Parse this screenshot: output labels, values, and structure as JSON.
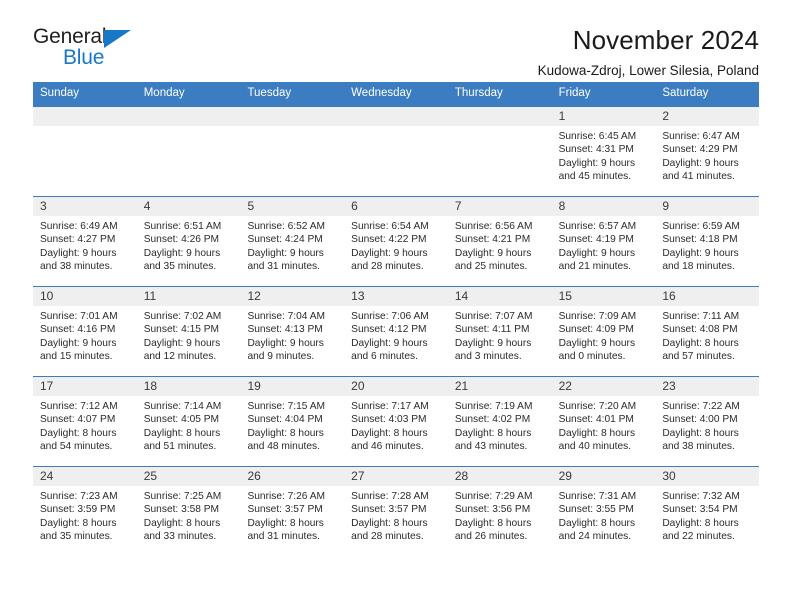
{
  "brand": {
    "name_part1": "General",
    "name_part2": "Blue",
    "accent_color": "#1878c8"
  },
  "header": {
    "title": "November 2024",
    "subtitle": "Kudowa-Zdroj, Lower Silesia, Poland"
  },
  "calendar": {
    "header_color": "#3b7dc0",
    "date_band_color": "#efefef",
    "weekdays": [
      "Sunday",
      "Monday",
      "Tuesday",
      "Wednesday",
      "Thursday",
      "Friday",
      "Saturday"
    ],
    "weeks": [
      [
        {
          "date": "",
          "empty": true
        },
        {
          "date": "",
          "empty": true
        },
        {
          "date": "",
          "empty": true
        },
        {
          "date": "",
          "empty": true
        },
        {
          "date": "",
          "empty": true
        },
        {
          "date": "1",
          "sunrise": "Sunrise: 6:45 AM",
          "sunset": "Sunset: 4:31 PM",
          "daylight": "Daylight: 9 hours and 45 minutes."
        },
        {
          "date": "2",
          "sunrise": "Sunrise: 6:47 AM",
          "sunset": "Sunset: 4:29 PM",
          "daylight": "Daylight: 9 hours and 41 minutes."
        }
      ],
      [
        {
          "date": "3",
          "sunrise": "Sunrise: 6:49 AM",
          "sunset": "Sunset: 4:27 PM",
          "daylight": "Daylight: 9 hours and 38 minutes."
        },
        {
          "date": "4",
          "sunrise": "Sunrise: 6:51 AM",
          "sunset": "Sunset: 4:26 PM",
          "daylight": "Daylight: 9 hours and 35 minutes."
        },
        {
          "date": "5",
          "sunrise": "Sunrise: 6:52 AM",
          "sunset": "Sunset: 4:24 PM",
          "daylight": "Daylight: 9 hours and 31 minutes."
        },
        {
          "date": "6",
          "sunrise": "Sunrise: 6:54 AM",
          "sunset": "Sunset: 4:22 PM",
          "daylight": "Daylight: 9 hours and 28 minutes."
        },
        {
          "date": "7",
          "sunrise": "Sunrise: 6:56 AM",
          "sunset": "Sunset: 4:21 PM",
          "daylight": "Daylight: 9 hours and 25 minutes."
        },
        {
          "date": "8",
          "sunrise": "Sunrise: 6:57 AM",
          "sunset": "Sunset: 4:19 PM",
          "daylight": "Daylight: 9 hours and 21 minutes."
        },
        {
          "date": "9",
          "sunrise": "Sunrise: 6:59 AM",
          "sunset": "Sunset: 4:18 PM",
          "daylight": "Daylight: 9 hours and 18 minutes."
        }
      ],
      [
        {
          "date": "10",
          "sunrise": "Sunrise: 7:01 AM",
          "sunset": "Sunset: 4:16 PM",
          "daylight": "Daylight: 9 hours and 15 minutes."
        },
        {
          "date": "11",
          "sunrise": "Sunrise: 7:02 AM",
          "sunset": "Sunset: 4:15 PM",
          "daylight": "Daylight: 9 hours and 12 minutes."
        },
        {
          "date": "12",
          "sunrise": "Sunrise: 7:04 AM",
          "sunset": "Sunset: 4:13 PM",
          "daylight": "Daylight: 9 hours and 9 minutes."
        },
        {
          "date": "13",
          "sunrise": "Sunrise: 7:06 AM",
          "sunset": "Sunset: 4:12 PM",
          "daylight": "Daylight: 9 hours and 6 minutes."
        },
        {
          "date": "14",
          "sunrise": "Sunrise: 7:07 AM",
          "sunset": "Sunset: 4:11 PM",
          "daylight": "Daylight: 9 hours and 3 minutes."
        },
        {
          "date": "15",
          "sunrise": "Sunrise: 7:09 AM",
          "sunset": "Sunset: 4:09 PM",
          "daylight": "Daylight: 9 hours and 0 minutes."
        },
        {
          "date": "16",
          "sunrise": "Sunrise: 7:11 AM",
          "sunset": "Sunset: 4:08 PM",
          "daylight": "Daylight: 8 hours and 57 minutes."
        }
      ],
      [
        {
          "date": "17",
          "sunrise": "Sunrise: 7:12 AM",
          "sunset": "Sunset: 4:07 PM",
          "daylight": "Daylight: 8 hours and 54 minutes."
        },
        {
          "date": "18",
          "sunrise": "Sunrise: 7:14 AM",
          "sunset": "Sunset: 4:05 PM",
          "daylight": "Daylight: 8 hours and 51 minutes."
        },
        {
          "date": "19",
          "sunrise": "Sunrise: 7:15 AM",
          "sunset": "Sunset: 4:04 PM",
          "daylight": "Daylight: 8 hours and 48 minutes."
        },
        {
          "date": "20",
          "sunrise": "Sunrise: 7:17 AM",
          "sunset": "Sunset: 4:03 PM",
          "daylight": "Daylight: 8 hours and 46 minutes."
        },
        {
          "date": "21",
          "sunrise": "Sunrise: 7:19 AM",
          "sunset": "Sunset: 4:02 PM",
          "daylight": "Daylight: 8 hours and 43 minutes."
        },
        {
          "date": "22",
          "sunrise": "Sunrise: 7:20 AM",
          "sunset": "Sunset: 4:01 PM",
          "daylight": "Daylight: 8 hours and 40 minutes."
        },
        {
          "date": "23",
          "sunrise": "Sunrise: 7:22 AM",
          "sunset": "Sunset: 4:00 PM",
          "daylight": "Daylight: 8 hours and 38 minutes."
        }
      ],
      [
        {
          "date": "24",
          "sunrise": "Sunrise: 7:23 AM",
          "sunset": "Sunset: 3:59 PM",
          "daylight": "Daylight: 8 hours and 35 minutes."
        },
        {
          "date": "25",
          "sunrise": "Sunrise: 7:25 AM",
          "sunset": "Sunset: 3:58 PM",
          "daylight": "Daylight: 8 hours and 33 minutes."
        },
        {
          "date": "26",
          "sunrise": "Sunrise: 7:26 AM",
          "sunset": "Sunset: 3:57 PM",
          "daylight": "Daylight: 8 hours and 31 minutes."
        },
        {
          "date": "27",
          "sunrise": "Sunrise: 7:28 AM",
          "sunset": "Sunset: 3:57 PM",
          "daylight": "Daylight: 8 hours and 28 minutes."
        },
        {
          "date": "28",
          "sunrise": "Sunrise: 7:29 AM",
          "sunset": "Sunset: 3:56 PM",
          "daylight": "Daylight: 8 hours and 26 minutes."
        },
        {
          "date": "29",
          "sunrise": "Sunrise: 7:31 AM",
          "sunset": "Sunset: 3:55 PM",
          "daylight": "Daylight: 8 hours and 24 minutes."
        },
        {
          "date": "30",
          "sunrise": "Sunrise: 7:32 AM",
          "sunset": "Sunset: 3:54 PM",
          "daylight": "Daylight: 8 hours and 22 minutes."
        }
      ]
    ]
  }
}
